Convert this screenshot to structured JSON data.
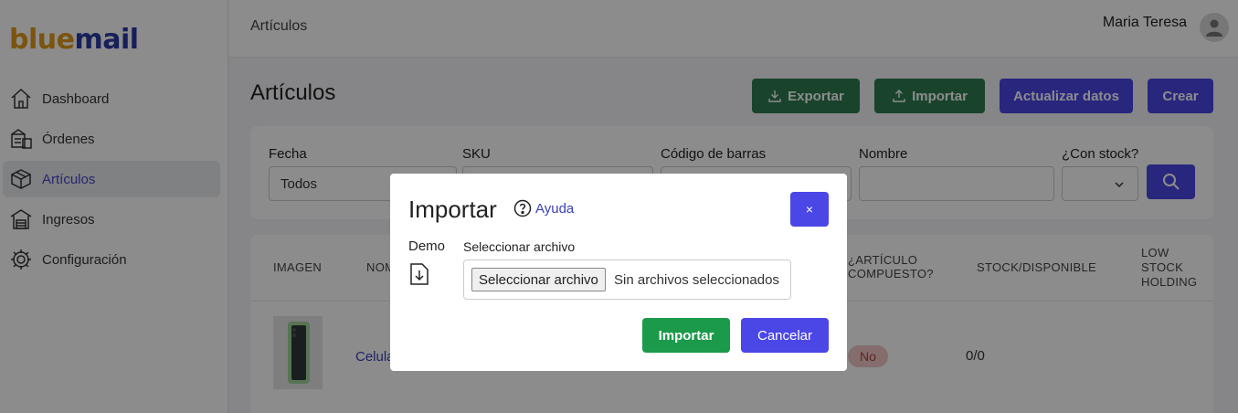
{
  "brand": {
    "part1": "blue",
    "part2": "mail"
  },
  "sidebar": {
    "items": [
      {
        "label": "Dashboard",
        "icon": "home-icon"
      },
      {
        "label": "Órdenes",
        "icon": "orders-icon"
      },
      {
        "label": "Artículos",
        "icon": "box-icon",
        "active": true
      },
      {
        "label": "Ingresos",
        "icon": "warehouse-icon"
      },
      {
        "label": "Configuración",
        "icon": "gear-icon"
      }
    ]
  },
  "header": {
    "breadcrumb": "Artículos",
    "user": "Maria Teresa",
    "avatar_icon": "user-icon"
  },
  "page": {
    "title": "Artículos",
    "buttons": {
      "exportar": "Exportar",
      "importar": "Importar",
      "actualizar": "Actualizar datos",
      "crear": "Crear"
    }
  },
  "filters": {
    "fecha": {
      "label": "Fecha",
      "value": "Todos"
    },
    "sku": {
      "label": "SKU",
      "value": ""
    },
    "barcode": {
      "label": "Código de barras",
      "value": ""
    },
    "nombre": {
      "label": "Nombre",
      "value": ""
    },
    "stock": {
      "label": "¿Con stock?",
      "value": ""
    }
  },
  "table": {
    "headers": {
      "imagen": "IMAGEN",
      "nombre": "NOM",
      "compuesto_1": "¿ARTÍCULO",
      "compuesto_2": "COMPUESTO?",
      "stock": "STOCK/DISPONIBLE",
      "low_1": "LOW",
      "low_2": "STOCK",
      "low_3": "HOLDING"
    },
    "rows": [
      {
        "name": "Celula",
        "compuesto": "No",
        "stock": "0/0"
      }
    ]
  },
  "modal": {
    "title": "Importar",
    "help": "Ayuda",
    "close": "×",
    "demo_label": "Demo",
    "file_label": "Seleccionar archivo",
    "file_button": "Seleccionar archivo",
    "file_status": "Sin archivos seleccionados",
    "import_button": "Importar",
    "cancel_button": "Cancelar"
  },
  "colors": {
    "primary": "#4b46e6",
    "success": "#1a9a4a",
    "dark_green": "#2e7d4f",
    "brand_orange": "#e09a1b",
    "brand_blue": "#2b3aa6"
  }
}
